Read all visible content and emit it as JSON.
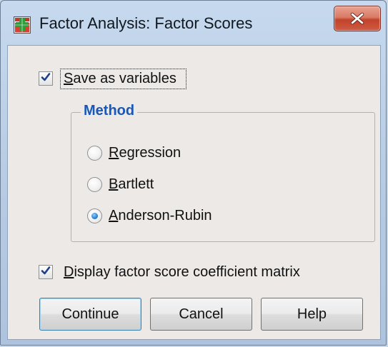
{
  "window": {
    "title": "Factor Analysis: Factor Scores",
    "app_icon": "spss-dialog-icon",
    "close_icon": "close-icon"
  },
  "save_as_variables": {
    "label": "Save as variables",
    "checked": true
  },
  "method": {
    "group_label": "Method",
    "options": [
      {
        "label": "Regression",
        "selected": false
      },
      {
        "label": "Bartlett",
        "selected": false
      },
      {
        "label": "Anderson-Rubin",
        "selected": true
      }
    ]
  },
  "display_matrix": {
    "label": "Display factor score coefficient matrix",
    "checked": true
  },
  "buttons": {
    "continue": "Continue",
    "cancel": "Cancel",
    "help": "Help"
  },
  "colors": {
    "group_title": "#1a58b8",
    "close_button": "#c2432a",
    "dialog_background": "#ece9e6"
  }
}
